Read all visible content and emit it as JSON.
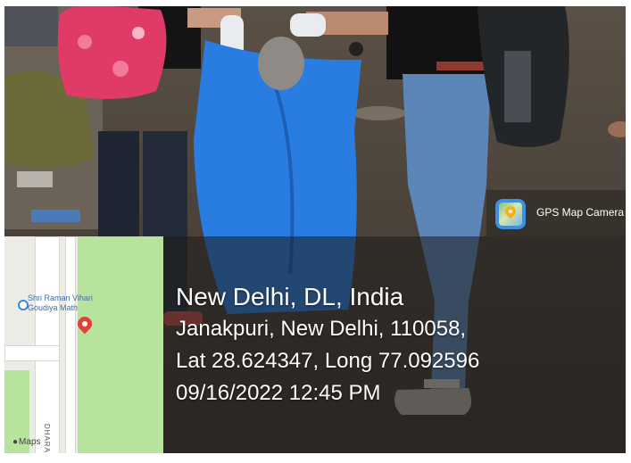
{
  "gps_badge": {
    "app_name": "GPS Map Camera",
    "icon": "gps-map-camera-app-icon"
  },
  "location": {
    "city": "New Delhi, DL, India",
    "address": "Janakpuri, New Delhi, 110058,",
    "coordinates": "Lat 28.624347, Long 77.092596",
    "datetime": "09/16/2022 12:45 PM"
  },
  "map": {
    "poi_label": "Shri Raman Vihari Goudiya Math",
    "road_label": "DHARA",
    "brand": "Maps",
    "pin_icon": "map-pin-icon",
    "pin_color": "#e2403a"
  },
  "colors": {
    "bag": "#2a7de0",
    "shirt": "#121212",
    "jeans": "#5c86b8",
    "backpack": "#e03a67"
  }
}
